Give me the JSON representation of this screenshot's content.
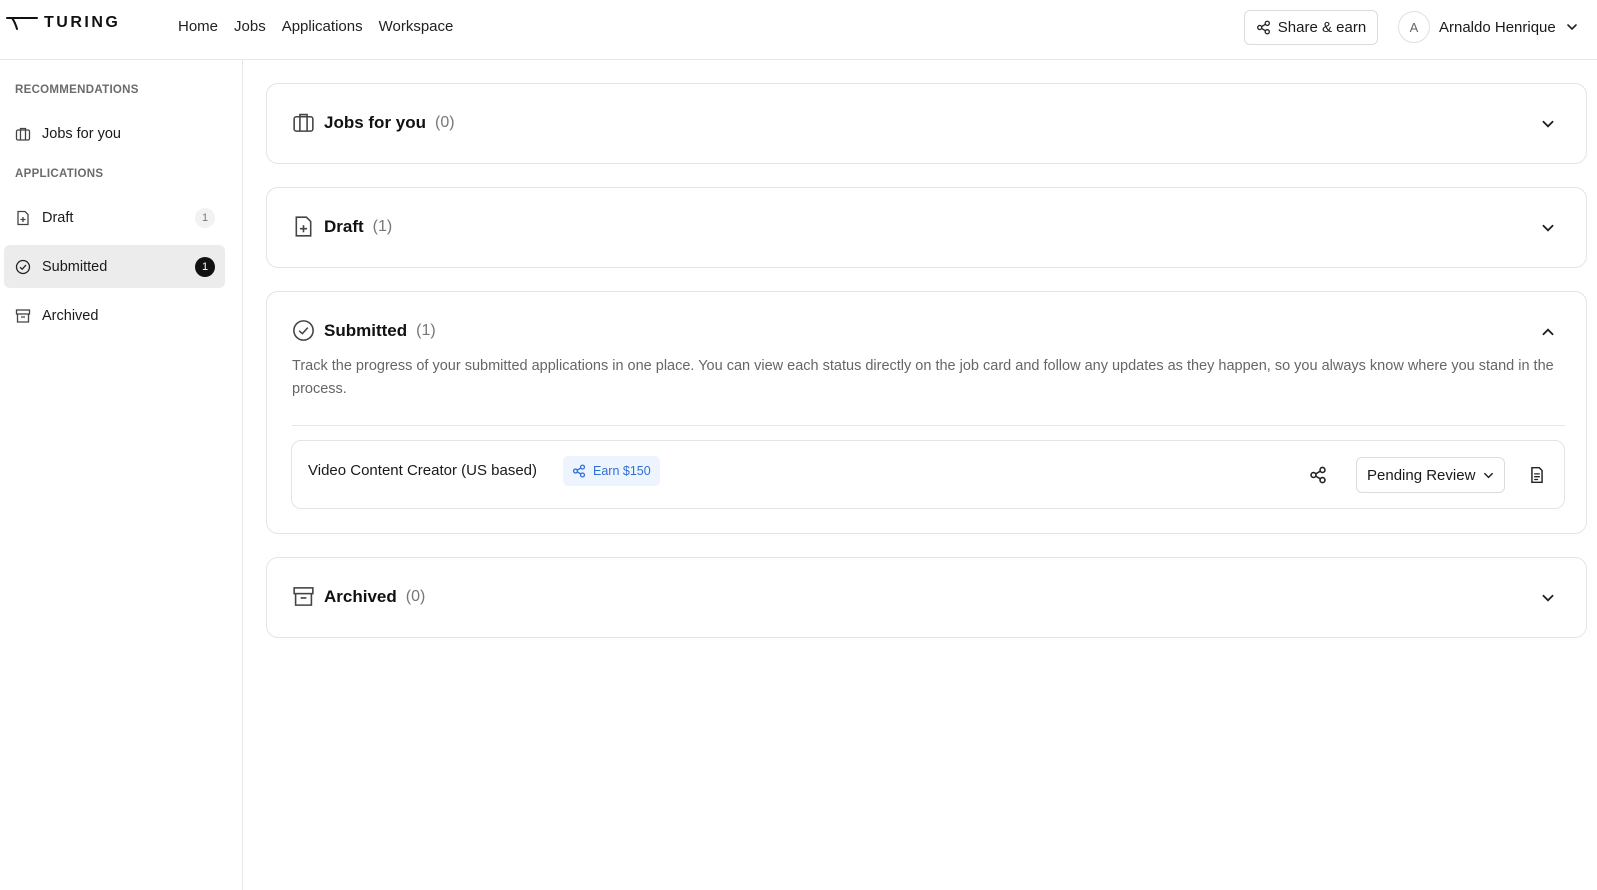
{
  "header": {
    "logo_text": "TURING",
    "nav": [
      "Home",
      "Jobs",
      "Applications",
      "Workspace"
    ],
    "share_label": "Share & earn",
    "user": {
      "initial": "A",
      "name": "Arnaldo Henrique"
    }
  },
  "sidebar": {
    "sections": [
      {
        "title": "RECOMMENDATIONS",
        "items": [
          {
            "label": "Jobs for you",
            "icon": "briefcase-icon"
          }
        ]
      },
      {
        "title": "APPLICATIONS",
        "items": [
          {
            "label": "Draft",
            "icon": "file-plus-icon",
            "count": "1"
          },
          {
            "label": "Submitted",
            "icon": "check-circle-icon",
            "count": "1",
            "active": true
          },
          {
            "label": "Archived",
            "icon": "archive-icon"
          }
        ]
      }
    ]
  },
  "cards": {
    "jobs_for_you": {
      "title": "Jobs for you",
      "count": "(0)",
      "icon": "briefcase-icon",
      "expanded": false
    },
    "draft": {
      "title": "Draft",
      "count": "(1)",
      "icon": "file-plus-icon",
      "expanded": false
    },
    "submitted": {
      "title": "Submitted",
      "count": "(1)",
      "icon": "check-circle-icon",
      "expanded": true,
      "description": "Track the progress of your submitted applications in one place. You can view each status directly on the job card and follow any updates as they happen, so you always know where you stand in the process.",
      "jobs": [
        {
          "title": "Video Content Creator (US based)",
          "earn": "Earn $150",
          "status": "Pending Review"
        }
      ]
    },
    "archived": {
      "title": "Archived",
      "count": "(0)",
      "icon": "archive-icon",
      "expanded": false
    }
  },
  "colors": {
    "accent_blue": "#2f6fd6",
    "badge_bg": "#eef4fd",
    "active_bg": "#ececec",
    "border": "#e4e4e4"
  }
}
